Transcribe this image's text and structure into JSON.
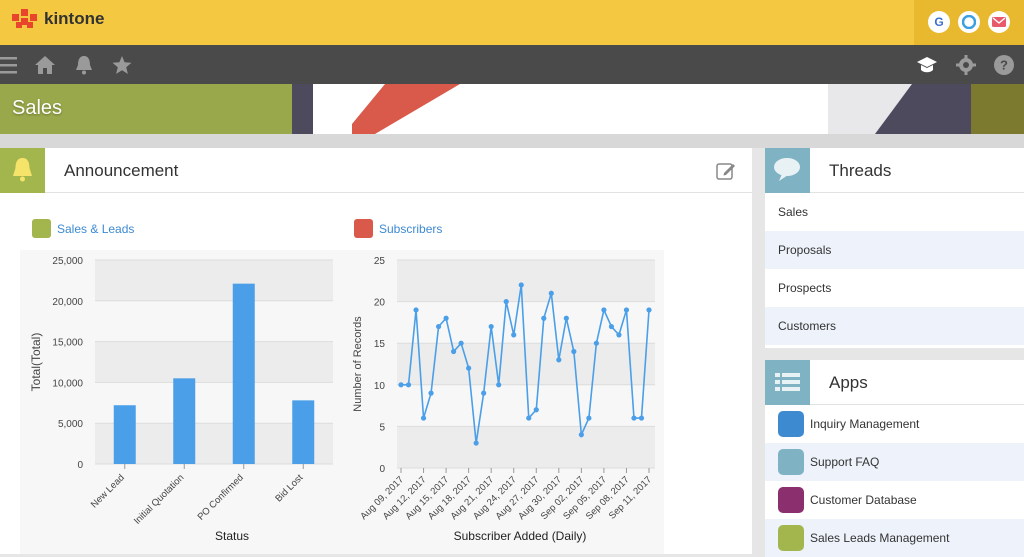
{
  "header": {
    "brand": "kintone",
    "brand_color": "#f5c842",
    "icons": [
      "google-icon",
      "chrome-icon",
      "mail-icon"
    ]
  },
  "nav": {
    "icons": [
      "menu-icon",
      "home-icon",
      "bell-icon",
      "star-icon",
      "graduation-cap-icon",
      "gear-icon",
      "help-icon"
    ]
  },
  "banner": {
    "title": "Sales"
  },
  "announcement": {
    "title": "Announcement"
  },
  "charts": {
    "left_title": "Sales & Leads",
    "right_title": "Subscribers"
  },
  "chart_data": [
    {
      "type": "bar",
      "title": "Sales & Leads",
      "xlabel": "Status",
      "ylabel": "Total(Total)",
      "categories": [
        "New Lead",
        "Initial Quotation",
        "PO Confirmed",
        "Bid Lost"
      ],
      "values": [
        7200,
        10500,
        22100,
        7800
      ],
      "ylim": [
        0,
        25000
      ],
      "yticks": [
        "0",
        "5,000",
        "10,000",
        "15,000",
        "20,000",
        "25,000"
      ],
      "color": "#4a9fe8"
    },
    {
      "type": "line",
      "title": "Subscribers",
      "xlabel": "Subscriber Added (Daily)",
      "ylabel": "Number of Records",
      "ylim": [
        0,
        25
      ],
      "yticks": [
        "0",
        "5",
        "10",
        "15",
        "20",
        "25"
      ],
      "xticks": [
        "Aug 09, 2017",
        "Aug 12, 2017",
        "Aug 15, 2017",
        "Aug 18, 2017",
        "Aug 21, 2017",
        "Aug 24, 2017",
        "Aug 27, 2017",
        "Aug 30, 2017",
        "Sep 02, 2017",
        "Sep 05, 2017",
        "Sep 08, 2017",
        "Sep 11, 2017"
      ],
      "values": [
        10,
        10,
        19,
        6,
        9,
        17,
        18,
        14,
        15,
        12,
        3,
        9,
        17,
        10,
        20,
        16,
        22,
        6,
        7,
        18,
        21,
        13,
        18,
        14,
        4,
        6,
        15,
        19,
        17,
        16,
        19,
        6,
        6,
        19
      ],
      "color": "#4a9fe8"
    }
  ],
  "threads": {
    "title": "Threads",
    "items": [
      "Sales",
      "Proposals",
      "Prospects",
      "Customers"
    ]
  },
  "apps": {
    "title": "Apps",
    "items": [
      {
        "label": "Inquiry Management",
        "color": "#3d8ad1"
      },
      {
        "label": "Support FAQ",
        "color": "#7fb3c4"
      },
      {
        "label": "Customer Database",
        "color": "#8b2f6e"
      },
      {
        "label": "Sales Leads Management",
        "color": "#a3b64e"
      }
    ]
  }
}
